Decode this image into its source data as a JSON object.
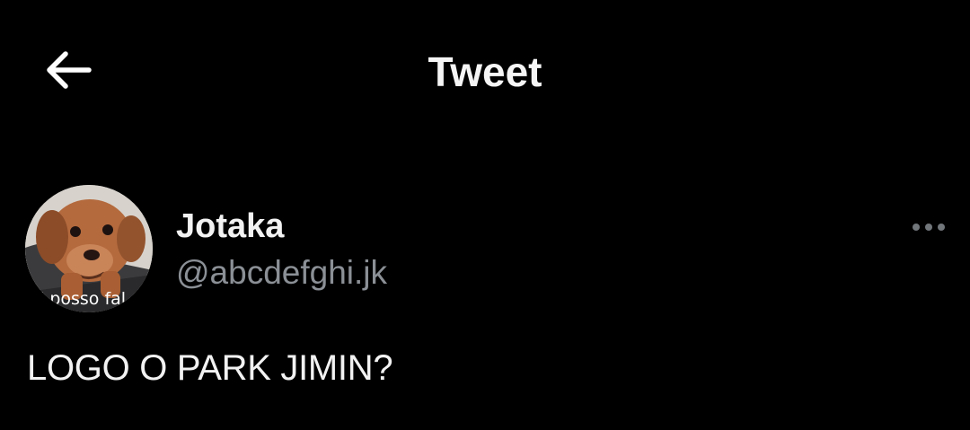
{
  "header": {
    "title": "Tweet",
    "back_icon": "arrow-left-icon"
  },
  "tweet": {
    "author": {
      "display_name": "Jotaka",
      "handle": "@abcdefghi.jk",
      "avatar_caption": "i posso fal"
    },
    "more_icon": "more-horizontal-icon",
    "text": "LOGO O PARK JIMIN?"
  },
  "colors": {
    "background": "#000000",
    "primary_text": "#e7e9ea",
    "secondary_text": "#71767b"
  }
}
